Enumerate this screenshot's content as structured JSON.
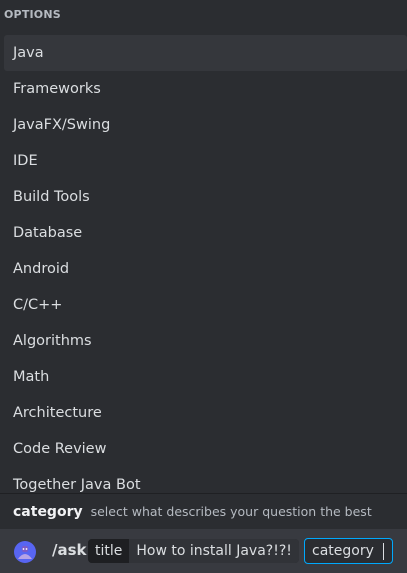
{
  "options_header": "OPTIONS",
  "options": [
    {
      "label": "Java",
      "selected": true
    },
    {
      "label": "Frameworks",
      "selected": false
    },
    {
      "label": "JavaFX/Swing",
      "selected": false
    },
    {
      "label": "IDE",
      "selected": false
    },
    {
      "label": "Build Tools",
      "selected": false
    },
    {
      "label": "Database",
      "selected": false
    },
    {
      "label": "Android",
      "selected": false
    },
    {
      "label": "C/C++",
      "selected": false
    },
    {
      "label": "Algorithms",
      "selected": false
    },
    {
      "label": "Math",
      "selected": false
    },
    {
      "label": "Architecture",
      "selected": false
    },
    {
      "label": "Code Review",
      "selected": false
    },
    {
      "label": "Together Java Bot",
      "selected": false
    }
  ],
  "param_hint": {
    "name": "category",
    "description": "select what describes your question the best"
  },
  "command_bar": {
    "bot_icon": "bot-avatar-icon",
    "command": "/ask",
    "filled_option": {
      "label": "title",
      "value": "How to install Java?!?!"
    },
    "active_option": "category"
  },
  "colors": {
    "background": "#2b2d31",
    "selected_row": "#35373c",
    "command_bar": "#383a40",
    "focus_border": "#00a8fc"
  }
}
